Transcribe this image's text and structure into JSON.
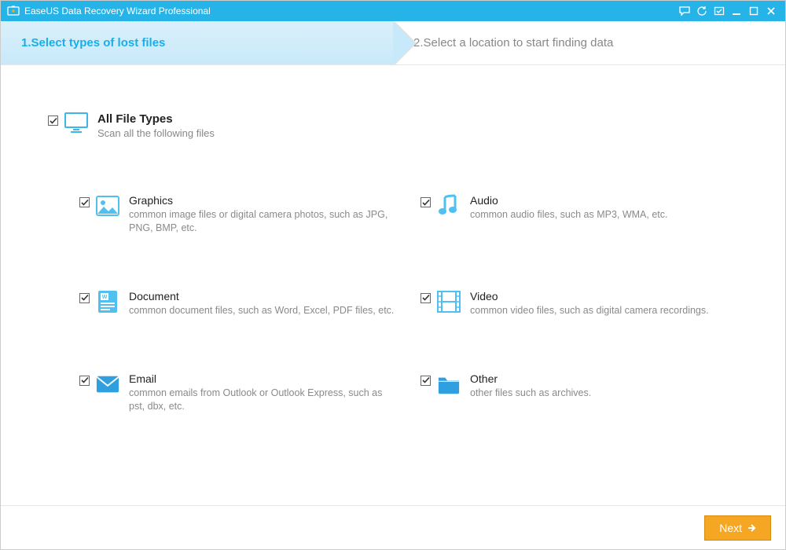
{
  "titlebar": {
    "title": "EaseUS Data Recovery Wizard Professional"
  },
  "steps": {
    "step1": "1.Select types of lost files",
    "step2": "2.Select a location to start finding data"
  },
  "all": {
    "title": "All File Types",
    "subtitle": "Scan all the following files"
  },
  "items": {
    "graphics": {
      "title": "Graphics",
      "desc": "common image files or digital camera photos, such as JPG, PNG, BMP, etc."
    },
    "audio": {
      "title": "Audio",
      "desc": "common audio files, such as MP3, WMA, etc."
    },
    "document": {
      "title": "Document",
      "desc": "common document files, such as Word, Excel, PDF files, etc."
    },
    "video": {
      "title": "Video",
      "desc": "common video files, such as digital camera recordings."
    },
    "email": {
      "title": "Email",
      "desc": "common emails from Outlook or Outlook Express, such as pst, dbx, etc."
    },
    "other": {
      "title": "Other",
      "desc": "other files such as archives."
    }
  },
  "footer": {
    "next": "Next"
  },
  "colors": {
    "brand": "#26b4e8",
    "accent": "#f5a623"
  }
}
